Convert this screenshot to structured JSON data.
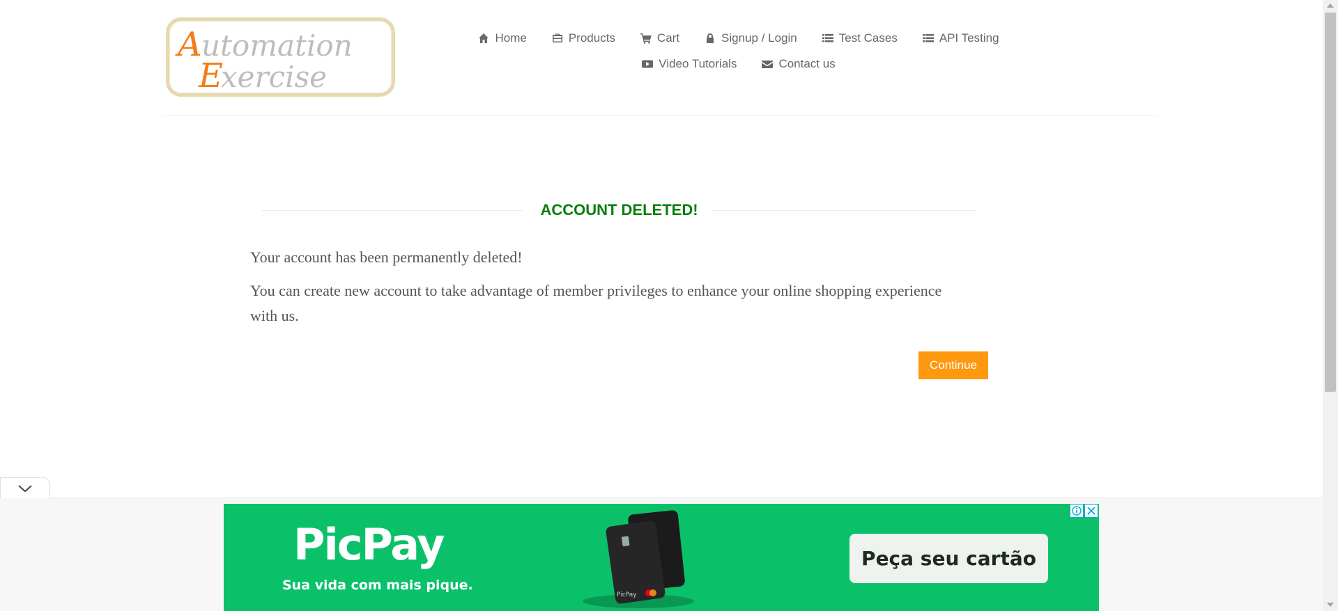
{
  "logo": {
    "line1": "Automation",
    "line2": "Exercise"
  },
  "nav": {
    "row1": [
      {
        "label": "Home",
        "icon": "home-icon"
      },
      {
        "label": "Products",
        "icon": "briefcase-icon"
      },
      {
        "label": "Cart",
        "icon": "cart-icon"
      },
      {
        "label": "Signup / Login",
        "icon": "lock-icon"
      },
      {
        "label": "Test Cases",
        "icon": "list-icon"
      },
      {
        "label": "API Testing",
        "icon": "list-icon"
      }
    ],
    "row2": [
      {
        "label": "Video Tutorials",
        "icon": "youtube-icon"
      },
      {
        "label": "Contact us",
        "icon": "envelope-icon"
      }
    ]
  },
  "main": {
    "title": "ACCOUNT DELETED!",
    "message1": "Your account has been permanently deleted!",
    "message2": "You can create new account to take advantage of member privileges to enhance your online shopping experience with us.",
    "continue_label": "Continue"
  },
  "ad": {
    "brand": "PicPay",
    "tagline": "Sua vida com mais pique.",
    "cta": "Peça seu cartão",
    "card_brand": "PicPay"
  },
  "colors": {
    "accent": "#fe980f",
    "title_green": "#0a7d0a",
    "ad_green": "#0ac16a",
    "text": "#696763"
  }
}
